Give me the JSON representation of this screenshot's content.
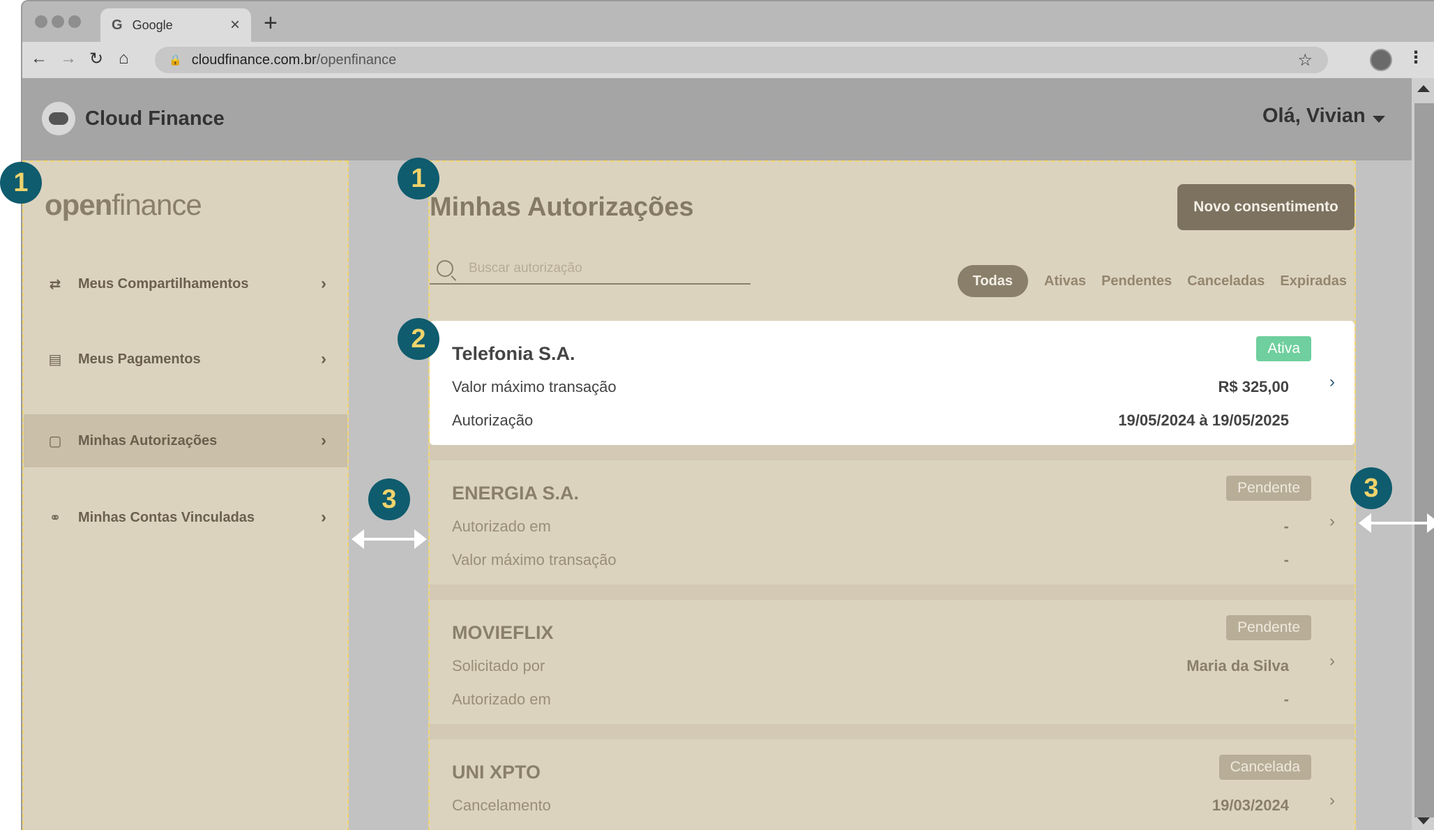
{
  "browser": {
    "tab_title": "Google",
    "url_domain": "cloudfinance.com.br",
    "url_path": "/openfinance"
  },
  "app": {
    "title": "Cloud Finance",
    "greeting": "Olá, Vivian"
  },
  "sidebar": {
    "logo_bold": "open",
    "logo_light": "finance",
    "items": [
      {
        "label": "Meus Compartilhamentos",
        "icon": "sync-icon"
      },
      {
        "label": "Meus Pagamentos",
        "icon": "payment-icon"
      },
      {
        "label": "Minhas Autorizações",
        "icon": "document-check-icon"
      },
      {
        "label": "Minhas Contas Vinculadas",
        "icon": "link-icon"
      }
    ]
  },
  "main": {
    "title": "Minhas Autorizações",
    "new_button": "Novo consentimento",
    "search_placeholder": "Buscar autorização",
    "filters": [
      "Todas",
      "Ativas",
      "Pendentes",
      "Canceladas",
      "Expiradas"
    ],
    "cards": [
      {
        "name": "Telefonia S.A.",
        "status": "Ativa",
        "rows": [
          {
            "label": "Valor máximo transação",
            "value": "R$ 325,00"
          },
          {
            "label": "Autorização",
            "value": "19/05/2024 à 19/05/2025"
          }
        ]
      },
      {
        "name": "ENERGIA S.A.",
        "status": "Pendente",
        "rows": [
          {
            "label": "Autorizado em",
            "value": "-"
          },
          {
            "label": "Valor máximo transação",
            "value": "-"
          }
        ]
      },
      {
        "name": "MOVIEFLIX",
        "status": "Pendente",
        "rows": [
          {
            "label": "Solicitado por",
            "value": "Maria da Silva"
          },
          {
            "label": "Autorizado em",
            "value": "-"
          }
        ]
      },
      {
        "name": "UNI XPTO",
        "status": "Cancelada",
        "rows": [
          {
            "label": "Cancelamento",
            "value": "19/03/2024"
          }
        ]
      }
    ]
  },
  "annotations": {
    "marker_1": "1",
    "marker_2": "2",
    "marker_3": "3"
  },
  "colors": {
    "accent": "#0f5c6e",
    "highlight_border": "#f0d36b",
    "status_active": "#6fcf9e"
  }
}
